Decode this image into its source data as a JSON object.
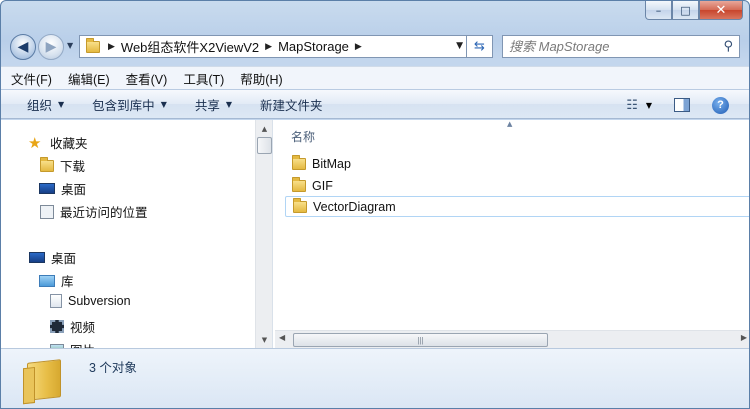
{
  "window": {
    "controls": {
      "minimize": "–",
      "maximize": "□",
      "close": "✕"
    }
  },
  "navbar": {
    "back_glyph": "◀",
    "forward_glyph": "▶",
    "breadcrumbs": [
      "Web组态软件X2ViewV2",
      "MapStorage"
    ],
    "search_placeholder": "搜索 MapStorage"
  },
  "menubar": {
    "items": [
      "文件(F)",
      "编辑(E)",
      "查看(V)",
      "工具(T)",
      "帮助(H)"
    ]
  },
  "commandbar": {
    "organize": "组织",
    "include_in_library": "包含到库中",
    "share": "共享",
    "new_folder": "新建文件夹"
  },
  "nav_pane": {
    "favorites": {
      "label": "收藏夹",
      "items": [
        "下载",
        "桌面",
        "最近访问的位置"
      ]
    },
    "desktop": "桌面",
    "library": {
      "label": "库",
      "items": [
        "Subversion",
        "视频",
        "图片"
      ]
    }
  },
  "file_list": {
    "column_name": "名称",
    "files": [
      {
        "name": "BitMap",
        "selected": false
      },
      {
        "name": "GIF",
        "selected": false
      },
      {
        "name": "VectorDiagram",
        "selected": true
      }
    ]
  },
  "details": {
    "item_count": "3 个对象"
  }
}
